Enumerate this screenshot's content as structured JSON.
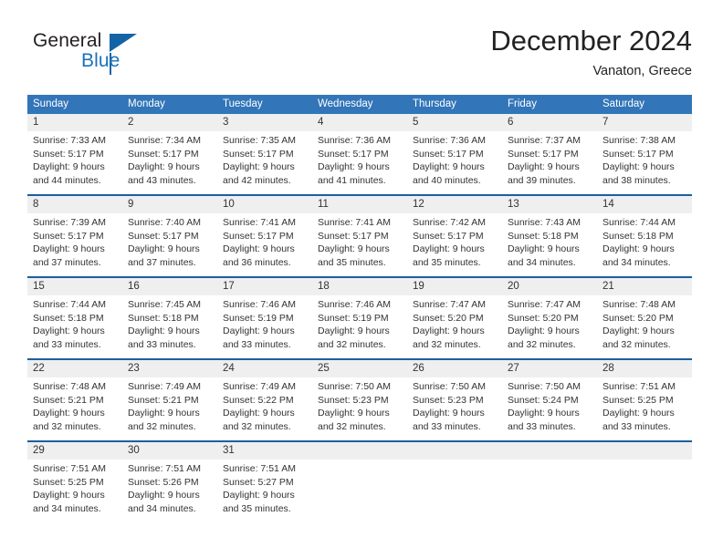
{
  "brand": {
    "name_part1": "General",
    "name_part2": "Blue",
    "logo_icon": "triangle-logo-icon"
  },
  "header": {
    "title": "December 2024",
    "subtitle": "Vanaton, Greece"
  },
  "colors": {
    "header_blue": "#3275b8",
    "week_divider_blue": "#1a5fa0",
    "date_band_gray": "#efefef",
    "brand_blue": "#1c71b9",
    "text": "#333333"
  },
  "calendar": {
    "weekday_headers": [
      "Sunday",
      "Monday",
      "Tuesday",
      "Wednesday",
      "Thursday",
      "Friday",
      "Saturday"
    ],
    "weeks": [
      {
        "days": [
          {
            "date": "1",
            "sunrise": "Sunrise: 7:33 AM",
            "sunset": "Sunset: 5:17 PM",
            "daylight_line1": "Daylight: 9 hours",
            "daylight_line2": "and 44 minutes."
          },
          {
            "date": "2",
            "sunrise": "Sunrise: 7:34 AM",
            "sunset": "Sunset: 5:17 PM",
            "daylight_line1": "Daylight: 9 hours",
            "daylight_line2": "and 43 minutes."
          },
          {
            "date": "3",
            "sunrise": "Sunrise: 7:35 AM",
            "sunset": "Sunset: 5:17 PM",
            "daylight_line1": "Daylight: 9 hours",
            "daylight_line2": "and 42 minutes."
          },
          {
            "date": "4",
            "sunrise": "Sunrise: 7:36 AM",
            "sunset": "Sunset: 5:17 PM",
            "daylight_line1": "Daylight: 9 hours",
            "daylight_line2": "and 41 minutes."
          },
          {
            "date": "5",
            "sunrise": "Sunrise: 7:36 AM",
            "sunset": "Sunset: 5:17 PM",
            "daylight_line1": "Daylight: 9 hours",
            "daylight_line2": "and 40 minutes."
          },
          {
            "date": "6",
            "sunrise": "Sunrise: 7:37 AM",
            "sunset": "Sunset: 5:17 PM",
            "daylight_line1": "Daylight: 9 hours",
            "daylight_line2": "and 39 minutes."
          },
          {
            "date": "7",
            "sunrise": "Sunrise: 7:38 AM",
            "sunset": "Sunset: 5:17 PM",
            "daylight_line1": "Daylight: 9 hours",
            "daylight_line2": "and 38 minutes."
          }
        ]
      },
      {
        "days": [
          {
            "date": "8",
            "sunrise": "Sunrise: 7:39 AM",
            "sunset": "Sunset: 5:17 PM",
            "daylight_line1": "Daylight: 9 hours",
            "daylight_line2": "and 37 minutes."
          },
          {
            "date": "9",
            "sunrise": "Sunrise: 7:40 AM",
            "sunset": "Sunset: 5:17 PM",
            "daylight_line1": "Daylight: 9 hours",
            "daylight_line2": "and 37 minutes."
          },
          {
            "date": "10",
            "sunrise": "Sunrise: 7:41 AM",
            "sunset": "Sunset: 5:17 PM",
            "daylight_line1": "Daylight: 9 hours",
            "daylight_line2": "and 36 minutes."
          },
          {
            "date": "11",
            "sunrise": "Sunrise: 7:41 AM",
            "sunset": "Sunset: 5:17 PM",
            "daylight_line1": "Daylight: 9 hours",
            "daylight_line2": "and 35 minutes."
          },
          {
            "date": "12",
            "sunrise": "Sunrise: 7:42 AM",
            "sunset": "Sunset: 5:17 PM",
            "daylight_line1": "Daylight: 9 hours",
            "daylight_line2": "and 35 minutes."
          },
          {
            "date": "13",
            "sunrise": "Sunrise: 7:43 AM",
            "sunset": "Sunset: 5:18 PM",
            "daylight_line1": "Daylight: 9 hours",
            "daylight_line2": "and 34 minutes."
          },
          {
            "date": "14",
            "sunrise": "Sunrise: 7:44 AM",
            "sunset": "Sunset: 5:18 PM",
            "daylight_line1": "Daylight: 9 hours",
            "daylight_line2": "and 34 minutes."
          }
        ]
      },
      {
        "days": [
          {
            "date": "15",
            "sunrise": "Sunrise: 7:44 AM",
            "sunset": "Sunset: 5:18 PM",
            "daylight_line1": "Daylight: 9 hours",
            "daylight_line2": "and 33 minutes."
          },
          {
            "date": "16",
            "sunrise": "Sunrise: 7:45 AM",
            "sunset": "Sunset: 5:18 PM",
            "daylight_line1": "Daylight: 9 hours",
            "daylight_line2": "and 33 minutes."
          },
          {
            "date": "17",
            "sunrise": "Sunrise: 7:46 AM",
            "sunset": "Sunset: 5:19 PM",
            "daylight_line1": "Daylight: 9 hours",
            "daylight_line2": "and 33 minutes."
          },
          {
            "date": "18",
            "sunrise": "Sunrise: 7:46 AM",
            "sunset": "Sunset: 5:19 PM",
            "daylight_line1": "Daylight: 9 hours",
            "daylight_line2": "and 32 minutes."
          },
          {
            "date": "19",
            "sunrise": "Sunrise: 7:47 AM",
            "sunset": "Sunset: 5:20 PM",
            "daylight_line1": "Daylight: 9 hours",
            "daylight_line2": "and 32 minutes."
          },
          {
            "date": "20",
            "sunrise": "Sunrise: 7:47 AM",
            "sunset": "Sunset: 5:20 PM",
            "daylight_line1": "Daylight: 9 hours",
            "daylight_line2": "and 32 minutes."
          },
          {
            "date": "21",
            "sunrise": "Sunrise: 7:48 AM",
            "sunset": "Sunset: 5:20 PM",
            "daylight_line1": "Daylight: 9 hours",
            "daylight_line2": "and 32 minutes."
          }
        ]
      },
      {
        "days": [
          {
            "date": "22",
            "sunrise": "Sunrise: 7:48 AM",
            "sunset": "Sunset: 5:21 PM",
            "daylight_line1": "Daylight: 9 hours",
            "daylight_line2": "and 32 minutes."
          },
          {
            "date": "23",
            "sunrise": "Sunrise: 7:49 AM",
            "sunset": "Sunset: 5:21 PM",
            "daylight_line1": "Daylight: 9 hours",
            "daylight_line2": "and 32 minutes."
          },
          {
            "date": "24",
            "sunrise": "Sunrise: 7:49 AM",
            "sunset": "Sunset: 5:22 PM",
            "daylight_line1": "Daylight: 9 hours",
            "daylight_line2": "and 32 minutes."
          },
          {
            "date": "25",
            "sunrise": "Sunrise: 7:50 AM",
            "sunset": "Sunset: 5:23 PM",
            "daylight_line1": "Daylight: 9 hours",
            "daylight_line2": "and 32 minutes."
          },
          {
            "date": "26",
            "sunrise": "Sunrise: 7:50 AM",
            "sunset": "Sunset: 5:23 PM",
            "daylight_line1": "Daylight: 9 hours",
            "daylight_line2": "and 33 minutes."
          },
          {
            "date": "27",
            "sunrise": "Sunrise: 7:50 AM",
            "sunset": "Sunset: 5:24 PM",
            "daylight_line1": "Daylight: 9 hours",
            "daylight_line2": "and 33 minutes."
          },
          {
            "date": "28",
            "sunrise": "Sunrise: 7:51 AM",
            "sunset": "Sunset: 5:25 PM",
            "daylight_line1": "Daylight: 9 hours",
            "daylight_line2": "and 33 minutes."
          }
        ]
      },
      {
        "days": [
          {
            "date": "29",
            "sunrise": "Sunrise: 7:51 AM",
            "sunset": "Sunset: 5:25 PM",
            "daylight_line1": "Daylight: 9 hours",
            "daylight_line2": "and 34 minutes."
          },
          {
            "date": "30",
            "sunrise": "Sunrise: 7:51 AM",
            "sunset": "Sunset: 5:26 PM",
            "daylight_line1": "Daylight: 9 hours",
            "daylight_line2": "and 34 minutes."
          },
          {
            "date": "31",
            "sunrise": "Sunrise: 7:51 AM",
            "sunset": "Sunset: 5:27 PM",
            "daylight_line1": "Daylight: 9 hours",
            "daylight_line2": "and 35 minutes."
          },
          {
            "date": "",
            "sunrise": "",
            "sunset": "",
            "daylight_line1": "",
            "daylight_line2": ""
          },
          {
            "date": "",
            "sunrise": "",
            "sunset": "",
            "daylight_line1": "",
            "daylight_line2": ""
          },
          {
            "date": "",
            "sunrise": "",
            "sunset": "",
            "daylight_line1": "",
            "daylight_line2": ""
          },
          {
            "date": "",
            "sunrise": "",
            "sunset": "",
            "daylight_line1": "",
            "daylight_line2": ""
          }
        ]
      }
    ]
  }
}
